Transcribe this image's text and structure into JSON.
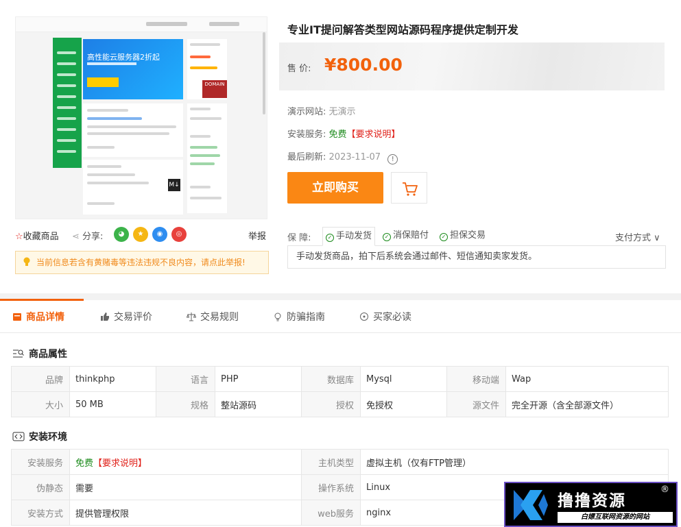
{
  "product": {
    "title": "专业IT提问解答类型网站源码程序提供定制开发",
    "price_label": "售  价:",
    "price": "¥800.00",
    "demo_label": "演示网站:",
    "demo_value": "无演示",
    "install_label": "安装服务:",
    "install_value": "免费",
    "install_link": "【要求说明】",
    "refresh_label": "最后刷新:",
    "refresh_value": "2023-11-07",
    "buy_label": "立即购买"
  },
  "guarantee": {
    "label": "保  障:",
    "items": [
      "手动发货",
      "消保赔付",
      "担保交易"
    ],
    "desc": "手动发货商品，拍下后系统会通过邮件、短信通知卖家发货。",
    "payment": "支付方式"
  },
  "actions": {
    "favorite": "收藏商品",
    "share": "分享:",
    "report": "举报",
    "notice": "当前信息若含有黄赌毒等违法违规不良内容，请点此举报!"
  },
  "tabs": [
    "商品详情",
    "交易评价",
    "交易规则",
    "防骗指南",
    "买家必读"
  ],
  "attributes": {
    "title": "商品属性",
    "rows": [
      [
        [
          "品牌",
          "thinkphp"
        ],
        [
          "语言",
          "PHP"
        ],
        [
          "数据库",
          "Mysql"
        ],
        [
          "移动端",
          "Wap"
        ]
      ],
      [
        [
          "大小",
          "50 MB"
        ],
        [
          "规格",
          "整站源码"
        ],
        [
          "授权",
          "免授权"
        ],
        [
          "源文件",
          "完全开源（含全部源文件）"
        ]
      ]
    ]
  },
  "environment": {
    "title": "安装环境",
    "rows": [
      [
        [
          "安装服务",
          "免费【要求说明】"
        ],
        [
          "主机类型",
          "虚拟主机（仅有FTP管理）"
        ]
      ],
      [
        [
          "伪静态",
          "需要"
        ],
        [
          "操作系统",
          "Linux"
        ]
      ],
      [
        [
          "安装方式",
          "提供管理权限"
        ],
        [
          "web服务",
          "nginx"
        ]
      ]
    ]
  },
  "thumbnail": {
    "banner_text": "高性能云服务器2折起",
    "domain_text": "DOMAIN",
    "md_text": "M↓"
  },
  "watermark": {
    "name": "撸撸资源",
    "reg": "®",
    "sub": "白嫖互联网资源的网站"
  },
  "colors": {
    "accent": "#f2610c",
    "buy": "#fa8714",
    "free": "#1a8a1a",
    "link": "#e0211a"
  }
}
